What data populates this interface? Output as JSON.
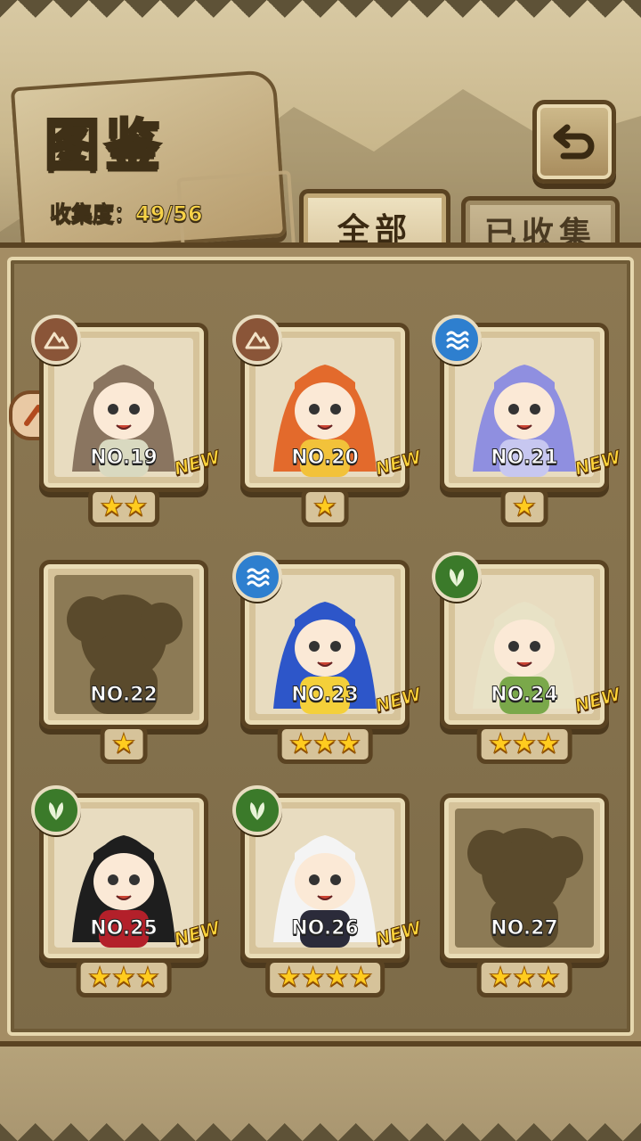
{
  "header": {
    "title": "图鉴",
    "collection_label": "收集度：",
    "collection_value": "49/56"
  },
  "tabs": [
    {
      "label": "全部",
      "active": true
    },
    {
      "label": "已收集",
      "active": false
    }
  ],
  "new_badge": "NEW",
  "cards": [
    {
      "number": "NO.19",
      "stars": 2,
      "element": "mountain-icon",
      "new": true,
      "locked": false,
      "hair": "#8a7560",
      "accent": "#d9d9c0"
    },
    {
      "number": "NO.20",
      "stars": 1,
      "element": "mountain-icon",
      "new": true,
      "locked": false,
      "hair": "#e36a2c",
      "accent": "#f2c23a"
    },
    {
      "number": "NO.21",
      "stars": 1,
      "element": "water-icon",
      "new": true,
      "locked": false,
      "hair": "#8f8fe0",
      "accent": "#c7c7f0"
    },
    {
      "number": "NO.22",
      "stars": 1,
      "element": "",
      "new": false,
      "locked": true
    },
    {
      "number": "NO.23",
      "stars": 3,
      "element": "water-icon",
      "new": true,
      "locked": false,
      "hair": "#2d56c9",
      "accent": "#f4d03a"
    },
    {
      "number": "NO.24",
      "stars": 3,
      "element": "leaf-icon",
      "new": true,
      "locked": false,
      "hair": "#e8e2c6",
      "accent": "#7aa84a"
    },
    {
      "number": "NO.25",
      "stars": 3,
      "element": "leaf-icon",
      "new": true,
      "locked": false,
      "hair": "#1e1e1e",
      "accent": "#b3202a"
    },
    {
      "number": "NO.26",
      "stars": 4,
      "element": "leaf-icon",
      "new": true,
      "locked": false,
      "hair": "#f4f4f4",
      "accent": "#2b2b3a"
    },
    {
      "number": "NO.27",
      "stars": 3,
      "element": "",
      "new": false,
      "locked": true
    }
  ],
  "colors": {
    "star": "#ffcc1f",
    "collection_value": "#f7d247",
    "frame_dark": "#5a4322"
  }
}
